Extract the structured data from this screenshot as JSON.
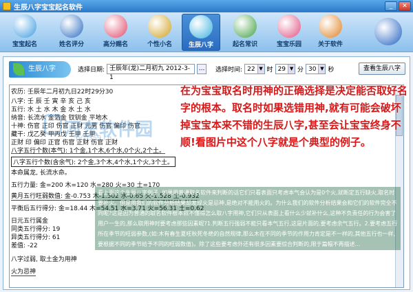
{
  "window": {
    "title": "生辰八字宝宝起名软件"
  },
  "toolbar": [
    {
      "label": "宝宝起名",
      "icon": "baby-icon",
      "color": "#3a9be0"
    },
    {
      "label": "姓名评分",
      "icon": "globe-icon",
      "color": "#2a6cc0"
    },
    {
      "label": "高分赐名",
      "icon": "flower-icon",
      "color": "#e04a6a"
    },
    {
      "label": "个性小名",
      "icon": "taiji-icon",
      "color": "#d0a020"
    },
    {
      "label": "生辰八字",
      "icon": "leaf-icon",
      "color": "#3ab0e0",
      "active": true
    },
    {
      "label": "起名常识",
      "icon": "drops-icon",
      "color": "#40a040"
    },
    {
      "label": "宝宝乐园",
      "icon": "heart-icon",
      "color": "#e05080"
    },
    {
      "label": "关于软件",
      "icon": "windows-icon",
      "color": "#e08020"
    },
    {
      "label": "?",
      "icon": "help-icon",
      "color": "#2060c0"
    }
  ],
  "panel": {
    "title": "生辰八字"
  },
  "controls": {
    "date_label": "选择日期:",
    "date_value": "壬辰年(龙)二月初九 2012-3-1",
    "ellipsis": "...",
    "time_label": "选择时间:",
    "hour": "22",
    "hour_unit": "时",
    "minute": "29",
    "minute_unit": "分",
    "second": "30",
    "second_unit": "秒",
    "view_button": "查看生辰八字"
  },
  "result_lines": [
    "农历: 壬辰年二月初九日22时29分30",
    "八字: 壬    辰        壬   寅        辛   亥       己   亥",
    "五行: 水    土        水   木        金   水       土   水",
    "纳音: 长流水          金箔金         钗钏金        平地木",
    "十神: 伤官  正印     伤官  正财      元男  伤官   偏印  伤官",
    "藏干: 戊乙癸          甲丙戊         壬甲          壬甲",
    "     正财 印   偏印   正官         伤官 正财      伤官 正财",
    "八字五行个数(本气): 1个金,1个木,6个水,0个火,2个土。",
    "八字五行个数(含余气): 2个金,3个木,4个水,1个火,3个土。",
    "本命属龙, 长流水命。",
    "五行力量: 金=200   木=120   水=280   火=30   土=170",
    "黄月五行旺弱数值: 金-0.753   木-1.502   水-0.65   火-1.528   土-0.932",
    "平衡后五行得分: 金=18.44   木=54.51   水=3.71   火=56.31   土=0.62",
    "日元五行属金",
    "同类五行得分: 19",
    "异类五行得分: 61",
    "差值: -22",
    "八字过弱, 取土金为用神",
    "火为忌神"
  ],
  "watermark": {
    "text": "河东软件园",
    "url": "pc0359.cn"
  },
  "overlay_heading": "在为宝宝取名时用神的正确选择是决定能否取好名字的根本。取名时如果选错用神,就有可能会破坏掉宝宝本来不错的生辰八字,甚至会让宝宝终身不顺!看图片中这个八字就是个典型的例子。",
  "note_text": "看上面这个生辰八字例子, 如果用普通取名软件来判断的话它们只看表面只考虑本气会认为是0个火,就断定五行缺火,取名时要补火。但是用我们的软件分析结果却发现火是忌神,是绝对不能用火的。为什么我们的软件分析结果会和它们的软件完全不同呢?这是因为普通的取名软件根本就不懂得怎么取八字用神,它们只从表面上看什么少就补什么,这种不负责任的行为会害了用户一生的,那么取用神时要考虑那些因素呢?1.判断五行强弱不能只看本气五行,这是片面的,要考虑余气五行。2.要考虑五行所在季节的旺弱参数,(如:木有春生夏旺秋死冬绝的自然规律,那么木在不同的季节的作用力肯定是不一样的,其他五行也一样,要根据不同的季节给予不同的旺弱数值)。除了这些要考虑外还有很多因素要综合判断的,限于篇幅不再描述..."
}
